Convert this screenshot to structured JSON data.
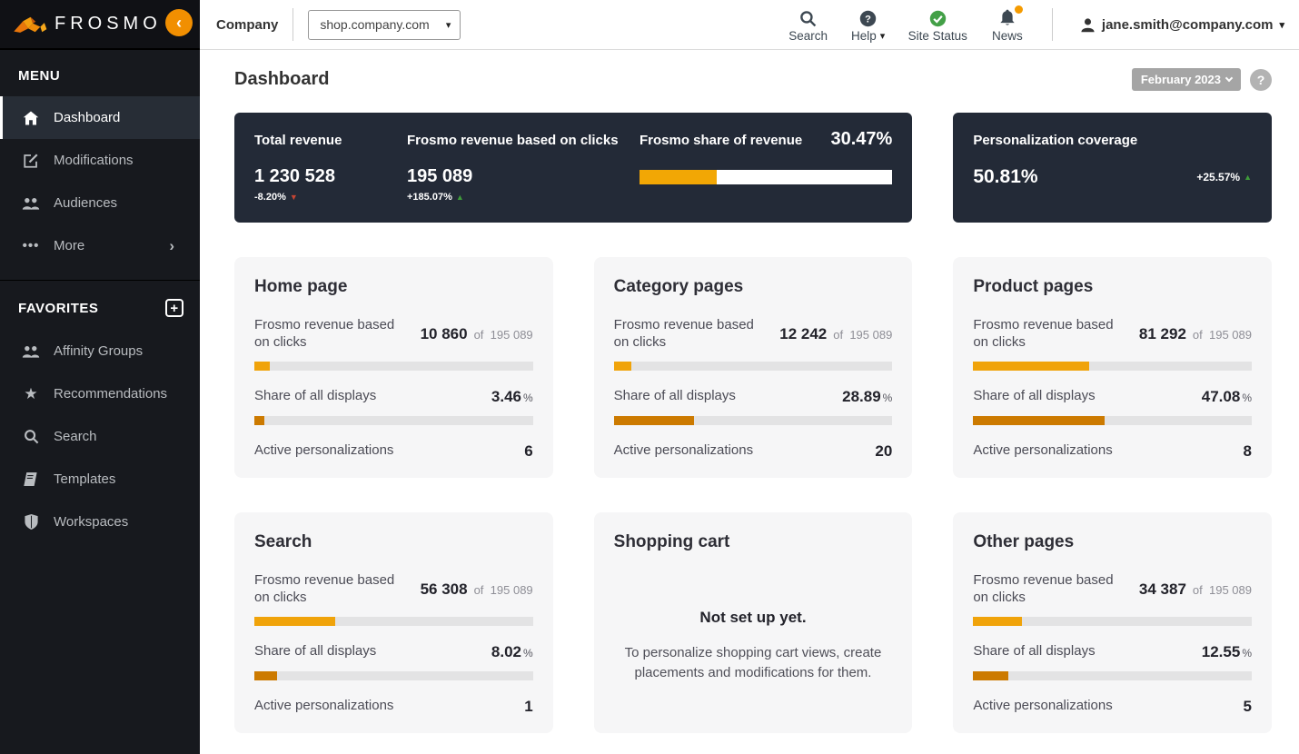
{
  "brand": {
    "name": "FROSMO"
  },
  "topbar": {
    "company_label": "Company",
    "site_selector_value": "shop.company.com",
    "nav": {
      "search": "Search",
      "help": "Help",
      "site_status": "Site Status",
      "news": "News"
    },
    "user_email": "jane.smith@company.com"
  },
  "sidebar": {
    "menu_header": "MENU",
    "menu_items": [
      {
        "label": "Dashboard"
      },
      {
        "label": "Modifications"
      },
      {
        "label": "Audiences"
      },
      {
        "label": "More"
      }
    ],
    "favorites_header": "FAVORITES",
    "favorites_items": [
      {
        "label": "Affinity Groups"
      },
      {
        "label": "Recommendations"
      },
      {
        "label": "Search"
      },
      {
        "label": "Templates"
      },
      {
        "label": "Workspaces"
      }
    ]
  },
  "page": {
    "title": "Dashboard",
    "period": "February 2023",
    "help": "?"
  },
  "labels": {
    "revenue": "Frosmo revenue based on clicks",
    "of": "of",
    "share": "Share of all displays",
    "share_unit": "%",
    "active": "Active personalizations"
  },
  "summary": {
    "total_revenue": {
      "label": "Total revenue",
      "value": "1 230 528",
      "change": "-8.20%",
      "direction": "down"
    },
    "frosmo_revenue": {
      "label": "Frosmo revenue based on clicks",
      "value": "195 089",
      "change": "+185.07%",
      "direction": "up"
    },
    "share_of_revenue": {
      "label": "Frosmo share of revenue",
      "value": "30.47%",
      "pct": 30.47
    },
    "coverage": {
      "label": "Personalization coverage",
      "value": "50.81%",
      "change": "+25.57%",
      "direction": "up"
    }
  },
  "cards": [
    {
      "title": "Home page",
      "revenue": "10 860",
      "total": "195 089",
      "revenue_pct": 5.57,
      "share": "3.46",
      "share_pct": 3.46,
      "active": "6"
    },
    {
      "title": "Category pages",
      "revenue": "12 242",
      "total": "195 089",
      "revenue_pct": 6.27,
      "share": "28.89",
      "share_pct": 28.89,
      "active": "20"
    },
    {
      "title": "Product pages",
      "revenue": "81 292",
      "total": "195 089",
      "revenue_pct": 41.67,
      "share": "47.08",
      "share_pct": 47.08,
      "active": "8"
    },
    {
      "title": "Search",
      "revenue": "56 308",
      "total": "195 089",
      "revenue_pct": 28.86,
      "share": "8.02",
      "share_pct": 8.02,
      "active": "1"
    },
    {
      "title": "Shopping cart",
      "empty_title": "Not set up yet.",
      "empty_text": "To personalize shopping cart views, create placements and modifications for them."
    },
    {
      "title": "Other pages",
      "revenue": "34 387",
      "total": "195 089",
      "revenue_pct": 17.63,
      "share": "12.55",
      "share_pct": 12.55,
      "active": "5"
    }
  ],
  "colors": {
    "brand_orange": "#f18f01",
    "amber_bar": "#f0a30a",
    "dark_orange_bar": "#cc7a00",
    "dark_card": "#232a37",
    "positive_green": "#3f9c3a",
    "negative_red": "#c64533",
    "news_badge": "#f59b00"
  }
}
